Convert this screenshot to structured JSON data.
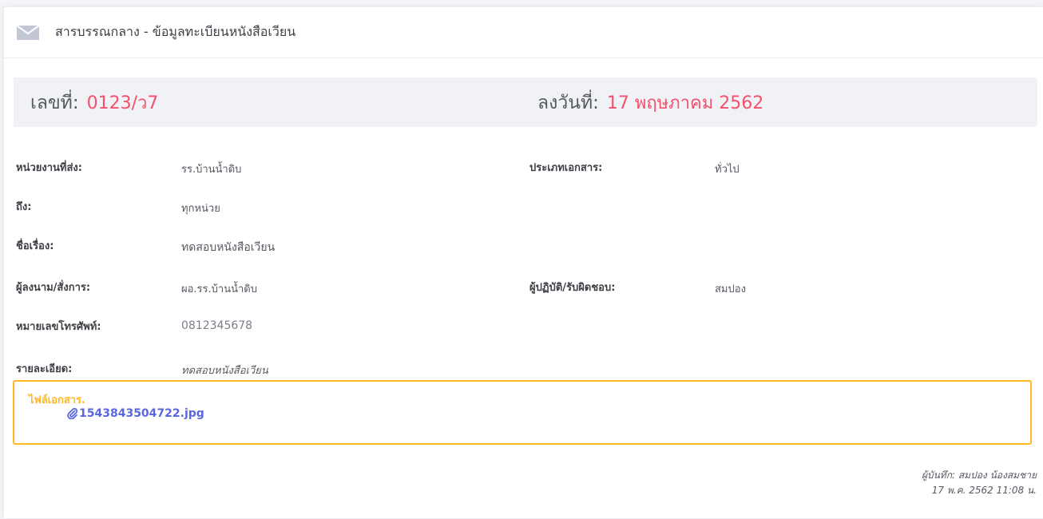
{
  "header": {
    "title": "สารบรรณกลาง - ข้อมูลทะเบียนหนังสือเวียน",
    "icon": "envelope-icon"
  },
  "summary": {
    "number_label": "เลขที่:",
    "number_value": "0123/ว7",
    "date_label": "ลงวันที่:",
    "date_value": "17 พฤษภาคม 2562"
  },
  "fields": {
    "sender_label": "หน่วยงานที่ส่ง:",
    "sender_value": "รร.บ้านน้ำดิบ",
    "doc_type_label": "ประเภทเอกสาร:",
    "doc_type_value": "ทั่วไป",
    "to_label": "ถึง:",
    "to_value": "ทุกหน่วย",
    "subject_label": "ชื่อเรื่อง:",
    "subject_value": "ทดสอบหนังสือเวียน",
    "signer_label": "ผู้ลงนาม/สั่งการ:",
    "signer_value": "ผอ.รร.บ้านน้ำดิบ",
    "responsible_label": "ผู้ปฏิบัติ/รับผิดชอบ:",
    "responsible_value": "สมปอง",
    "phone_label": "หมายเลขโทรศัพท์:",
    "phone_value": "0812345678",
    "detail_label": "รายละเอียด:",
    "detail_value": "ทดสอบหนังสือเวียน"
  },
  "attachments": {
    "title": "ไฟล์เอกสาร.",
    "files": [
      {
        "name": "1543843504722.jpg",
        "icon": "paperclip-icon"
      }
    ]
  },
  "record": {
    "recorder": "ผู้บันทึก: สมปอง น้องสมชาย",
    "timestamp": "17 พ.ค. 2562 11:08 น."
  },
  "colors": {
    "accent_red": "#f4516c",
    "warning": "#ffb822",
    "link": "#5867dd"
  }
}
